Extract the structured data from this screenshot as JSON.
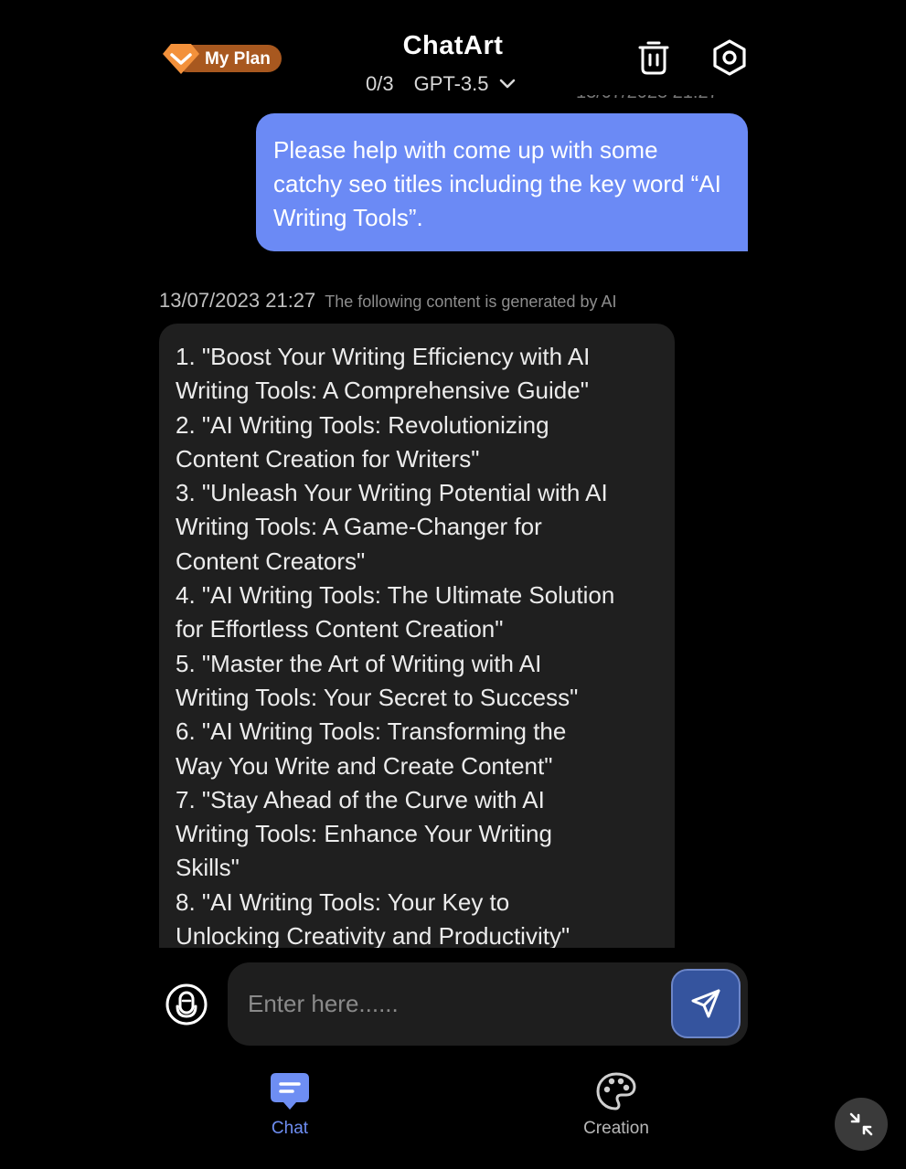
{
  "header": {
    "plan_label": "My Plan",
    "title": "ChatArt",
    "quota": "0/3",
    "model": "GPT-3.5",
    "hidden_timestamp": "13/07/2023 21:27"
  },
  "conversation": {
    "user_message": "Please help with come up with some catchy seo titles including the key word “AI Writing Tools”.",
    "ai_timestamp": "13/07/2023 21:27",
    "ai_note": "The following content is generated by AI",
    "ai_lines": [
      "1. \"Boost Your Writing Efficiency with AI",
      "Writing Tools: A Comprehensive Guide\"",
      "2. \"AI Writing Tools: Revolutionizing",
      "Content Creation for Writers\"",
      "3. \"Unleash Your Writing Potential with AI",
      "Writing Tools: A Game-Changer for",
      "Content Creators\"",
      "4. \"AI Writing Tools: The Ultimate Solution",
      "for Effortless Content Creation\"",
      "5. \"Master the Art of Writing with AI",
      "Writing Tools: Your Secret to Success\"",
      "6. \"AI Writing Tools: Transforming the",
      "Way You Write and Create Content\"",
      "7. \"Stay Ahead of the Curve with AI",
      "Writing Tools: Enhance Your Writing",
      "Skills\"",
      "8. \"AI Writing Tools: Your Key to",
      "Unlocking Creativity and Productivity\""
    ]
  },
  "input": {
    "placeholder": "Enter here......",
    "value": ""
  },
  "tabs": [
    {
      "label": "Chat",
      "active": true
    },
    {
      "label": "Creation",
      "active": false
    }
  ],
  "colors": {
    "background": "#000000",
    "accent": "#6b8af5",
    "plan_badge": "#a8581f",
    "ai_bubble": "#1f1f1f",
    "send_button": "#35549e"
  },
  "icons": {
    "plan": "diamond-icon",
    "trash": "trash-icon",
    "settings": "settings-icon",
    "model_dropdown": "chevron-down-icon",
    "mic": "microphone-icon",
    "send": "send-icon",
    "chat_tab": "chat-bubble-icon",
    "creation_tab": "palette-icon",
    "collapse": "collapse-icon"
  }
}
